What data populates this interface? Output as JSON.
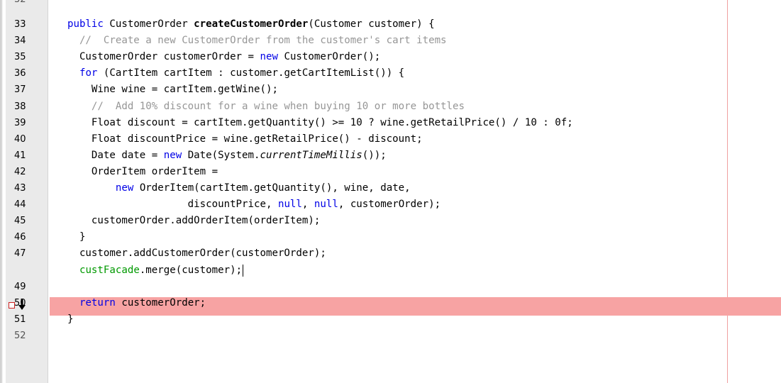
{
  "editor": {
    "partial_top_number": "32",
    "partial_bottom_number": "52",
    "lines": [
      {
        "number": "33",
        "segments": [
          {
            "text": "  public ",
            "cls": "kw"
          },
          {
            "text": "CustomerOrder ",
            "cls": ""
          },
          {
            "text": "createCustomerOrder",
            "cls": "bold"
          },
          {
            "text": "(Customer customer) {",
            "cls": ""
          }
        ]
      },
      {
        "number": "34",
        "segments": [
          {
            "text": "    //  Create a new CustomerOrder from the customer's cart items",
            "cls": "cm"
          }
        ]
      },
      {
        "number": "35",
        "segments": [
          {
            "text": "    CustomerOrder customerOrder = ",
            "cls": ""
          },
          {
            "text": "new ",
            "cls": "kw"
          },
          {
            "text": "CustomerOrder();",
            "cls": ""
          }
        ]
      },
      {
        "number": "36",
        "segments": [
          {
            "text": "    ",
            "cls": ""
          },
          {
            "text": "for ",
            "cls": "kw"
          },
          {
            "text": "(CartItem cartItem : customer.getCartItemList()) {",
            "cls": ""
          }
        ]
      },
      {
        "number": "37",
        "segments": [
          {
            "text": "      Wine wine = cartItem.getWine();",
            "cls": ""
          }
        ]
      },
      {
        "number": "38",
        "segments": [
          {
            "text": "      //  Add 10% discount for a wine when buying 10 or more bottles",
            "cls": "cm"
          }
        ]
      },
      {
        "number": "39",
        "segments": [
          {
            "text": "      Float discount = cartItem.getQuantity() >= 10 ? wine.getRetailPrice() / 10 : 0f;",
            "cls": ""
          }
        ]
      },
      {
        "number": "40",
        "segments": [
          {
            "text": "      Float discountPrice = wine.getRetailPrice() - discount;",
            "cls": ""
          }
        ]
      },
      {
        "number": "41",
        "segments": [
          {
            "text": "      Date date = ",
            "cls": ""
          },
          {
            "text": "new ",
            "cls": "kw"
          },
          {
            "text": "Date(System.",
            "cls": ""
          },
          {
            "text": "currentTimeMillis",
            "cls": "italic"
          },
          {
            "text": "());",
            "cls": ""
          }
        ]
      },
      {
        "number": "42",
        "segments": [
          {
            "text": "      OrderItem orderItem =",
            "cls": ""
          }
        ]
      },
      {
        "number": "43",
        "segments": [
          {
            "text": "          ",
            "cls": ""
          },
          {
            "text": "new ",
            "cls": "kw"
          },
          {
            "text": "OrderItem(cartItem.getQuantity(), wine, date,",
            "cls": ""
          }
        ]
      },
      {
        "number": "44",
        "segments": [
          {
            "text": "                      discountPrice, ",
            "cls": ""
          },
          {
            "text": "null",
            "cls": "kw"
          },
          {
            "text": ", ",
            "cls": ""
          },
          {
            "text": "null",
            "cls": "kw"
          },
          {
            "text": ", customerOrder);",
            "cls": ""
          }
        ]
      },
      {
        "number": "45",
        "segments": [
          {
            "text": "      customerOrder.addOrderItem(orderItem);",
            "cls": ""
          }
        ]
      },
      {
        "number": "46",
        "segments": [
          {
            "text": "    }",
            "cls": ""
          }
        ]
      },
      {
        "number": "47",
        "segments": [
          {
            "text": "    customer.addCustomerOrder(customerOrder);",
            "cls": ""
          }
        ]
      },
      {
        "number": "",
        "segments": [
          {
            "text": "    ",
            "cls": ""
          },
          {
            "text": "custFacade",
            "cls": "fld"
          },
          {
            "text": ".merge(customer);",
            "cls": ""
          }
        ]
      },
      {
        "number": "49",
        "segments": [
          {
            "text": "",
            "cls": ""
          }
        ]
      },
      {
        "number": "50",
        "segments": [
          {
            "text": "    ",
            "cls": ""
          },
          {
            "text": "return ",
            "cls": "kw"
          },
          {
            "text": "customerOrder;",
            "cls": ""
          }
        ]
      },
      {
        "number": "51",
        "segments": [
          {
            "text": "  }",
            "cls": ""
          }
        ]
      }
    ]
  },
  "icons": {
    "breakpoint": "breakpoint-icon",
    "current_line_arrow": "arrow-down-icon"
  },
  "colors": {
    "keyword": "#0000e6",
    "comment": "#969696",
    "field": "#009900",
    "highlight": "#f7a3a3",
    "gutter": "#eaeaea"
  }
}
